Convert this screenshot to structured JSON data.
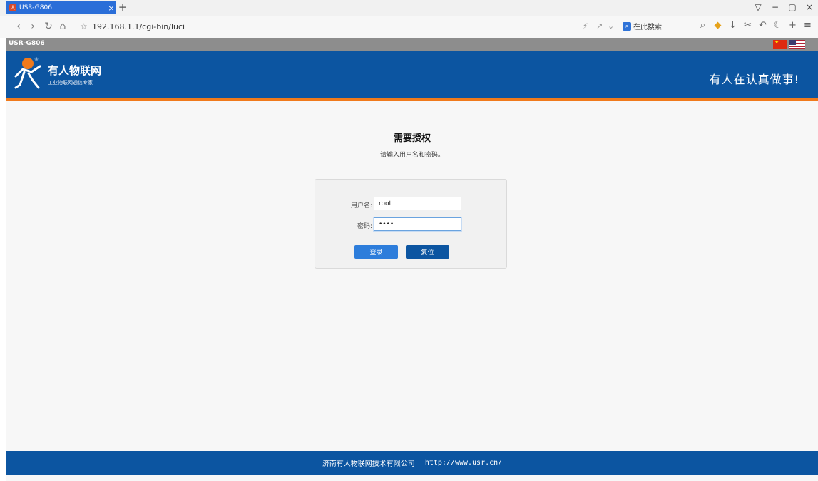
{
  "browser": {
    "tab_title": "USR-G806",
    "tab_close": "×",
    "new_tab": "+",
    "url": "192.168.1.1/cgi-bin/luci",
    "search_placeholder": "在此搜索",
    "window_controls": [
      "▽",
      "−",
      "▢",
      "×"
    ]
  },
  "page": {
    "model": "USR-G806",
    "brand_name": "有人物联网",
    "brand_tagline": "工业物联网通信专家",
    "slogan": "有人在认真做事!",
    "languages": [
      "zh-CN",
      "en-US"
    ],
    "colors": {
      "header": "#0c55a1",
      "accent": "#f07a1c",
      "login_button": "#2d7ddb",
      "reset_button": "#0c55a1"
    }
  },
  "auth": {
    "title": "需要授权",
    "description": "请输入用户名和密码。",
    "username_label": "用户名:",
    "username_value": "root",
    "password_label": "密码:",
    "password_value": "••••",
    "login_button": "登录",
    "reset_button": "复位"
  },
  "footer": {
    "company": "济南有人物联网技术有限公司",
    "url": "http://www.usr.cn/"
  }
}
